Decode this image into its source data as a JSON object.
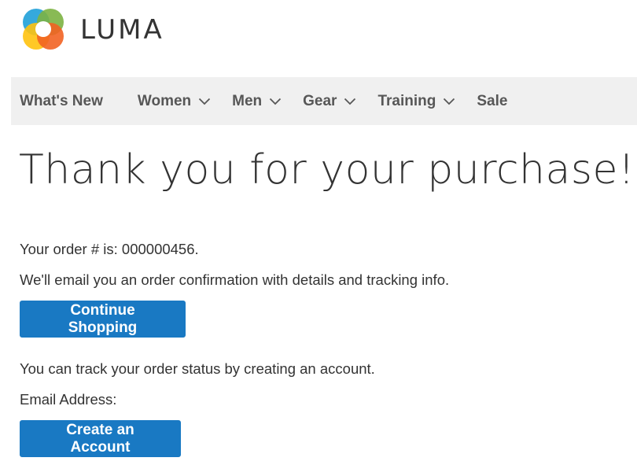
{
  "brand": {
    "name": "LUMA",
    "logo_icon": "luma-logo-icon",
    "colors": [
      "#f26322",
      "#7cb342",
      "#ffc20e",
      "#1fa0d8"
    ]
  },
  "nav": {
    "items": [
      {
        "label": "What's New",
        "has_dropdown": false
      },
      {
        "label": "Women",
        "has_dropdown": true
      },
      {
        "label": "Men",
        "has_dropdown": true
      },
      {
        "label": "Gear",
        "has_dropdown": true
      },
      {
        "label": "Training",
        "has_dropdown": true
      },
      {
        "label": "Sale",
        "has_dropdown": false
      }
    ],
    "dropdown_icon": "chevron-down-icon"
  },
  "main": {
    "title": "Thank you for your purchase!",
    "order_number_text": "Your order # is: 000000456.",
    "email_notice": "We'll email you an order confirmation with details and tracking info.",
    "continue_label": "Continue Shopping",
    "track_notice": "You can track your order status by creating an account.",
    "email_address_label": "Email Address:",
    "create_account_label": "Create an Account"
  },
  "colors": {
    "primary_button": "#1979c3",
    "nav_background": "#f0f0f0",
    "text": "#333333"
  }
}
